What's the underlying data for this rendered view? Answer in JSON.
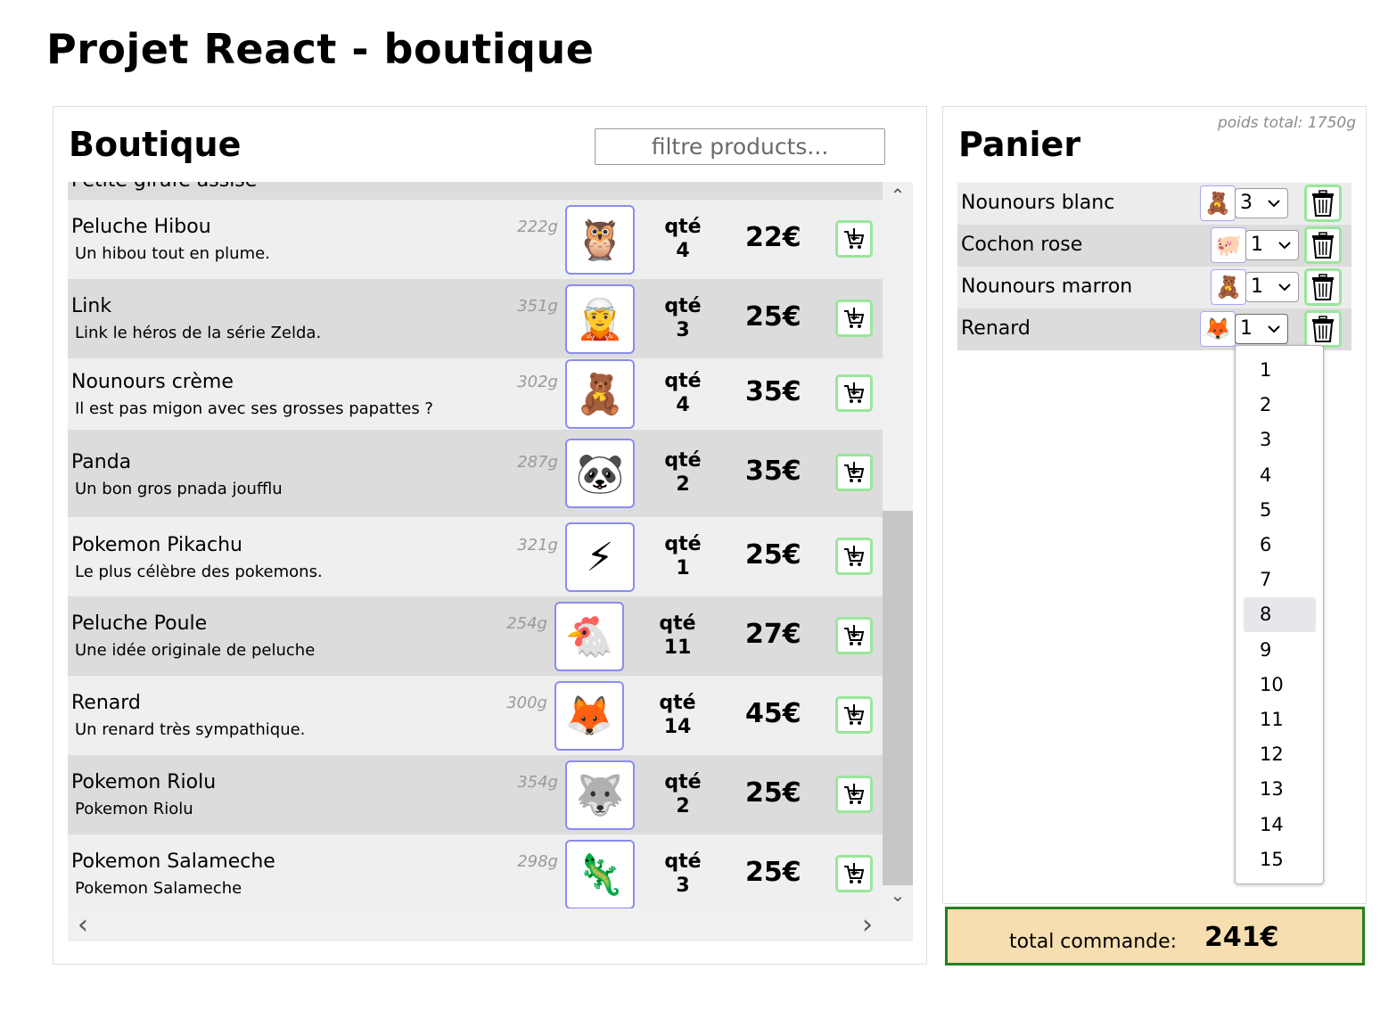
{
  "page": {
    "title": "Projet React - boutique"
  },
  "boutique": {
    "title": "Boutique",
    "filter_placeholder": "filtre products...",
    "partial_top_name": "Petite girafe assise",
    "products": [
      {
        "name": "Peluche Hibou",
        "desc": "Un hibou tout en plume.",
        "weight": "222g",
        "qty_label": "qté",
        "qty": "4",
        "price": "22€",
        "icon": "🦉"
      },
      {
        "name": "Link",
        "desc": "Link le héros de la série Zelda.",
        "weight": "351g",
        "qty_label": "qté",
        "qty": "3",
        "price": "25€",
        "icon": "🧝"
      },
      {
        "name": "Nounours crème",
        "desc": "Il est pas migon avec ses grosses papattes ?",
        "weight": "302g",
        "qty_label": "qté",
        "qty": "4",
        "price": "35€",
        "icon": "🧸"
      },
      {
        "name": "Panda",
        "desc": "Un bon gros pnada joufflu",
        "weight": "287g",
        "qty_label": "qté",
        "qty": "2",
        "price": "35€",
        "icon": "🐼"
      },
      {
        "name": "Pokemon Pikachu",
        "desc": "Le plus célèbre des pokemons.",
        "weight": "321g",
        "qty_label": "qté",
        "qty": "1",
        "price": "25€",
        "icon": "⚡"
      },
      {
        "name": "Peluche Poule",
        "desc": "Une idée originale de peluche",
        "weight": "254g",
        "qty_label": "qté",
        "qty": "11",
        "price": "27€",
        "icon": "🐔"
      },
      {
        "name": "Renard",
        "desc": "Un renard très sympathique.",
        "weight": "300g",
        "qty_label": "qté",
        "qty": "14",
        "price": "45€",
        "icon": "🦊"
      },
      {
        "name": "Pokemon Riolu",
        "desc": "Pokemon Riolu",
        "weight": "354g",
        "qty_label": "qté",
        "qty": "2",
        "price": "25€",
        "icon": "🐺"
      },
      {
        "name": "Pokemon Salameche",
        "desc": "Pokemon Salameche",
        "weight": "298g",
        "qty_label": "qté",
        "qty": "3",
        "price": "25€",
        "icon": "🦎"
      }
    ]
  },
  "panier": {
    "title": "Panier",
    "poids_total": "poids total: 1750g",
    "items": [
      {
        "name": "Nounours blanc",
        "qty": "3",
        "icon": "🧸"
      },
      {
        "name": "Cochon rose",
        "qty": "1",
        "icon": "🐖"
      },
      {
        "name": "Nounours marron",
        "qty": "1",
        "icon": "🧸"
      },
      {
        "name": "Renard",
        "qty": "1",
        "icon": "🦊"
      }
    ],
    "dropdown_options": [
      "1",
      "2",
      "3",
      "4",
      "5",
      "6",
      "7",
      "8",
      "9",
      "10",
      "11",
      "12",
      "13",
      "14",
      "15"
    ],
    "dropdown_highlighted": "8",
    "total_label": "total commande:",
    "total_value": "241€"
  }
}
